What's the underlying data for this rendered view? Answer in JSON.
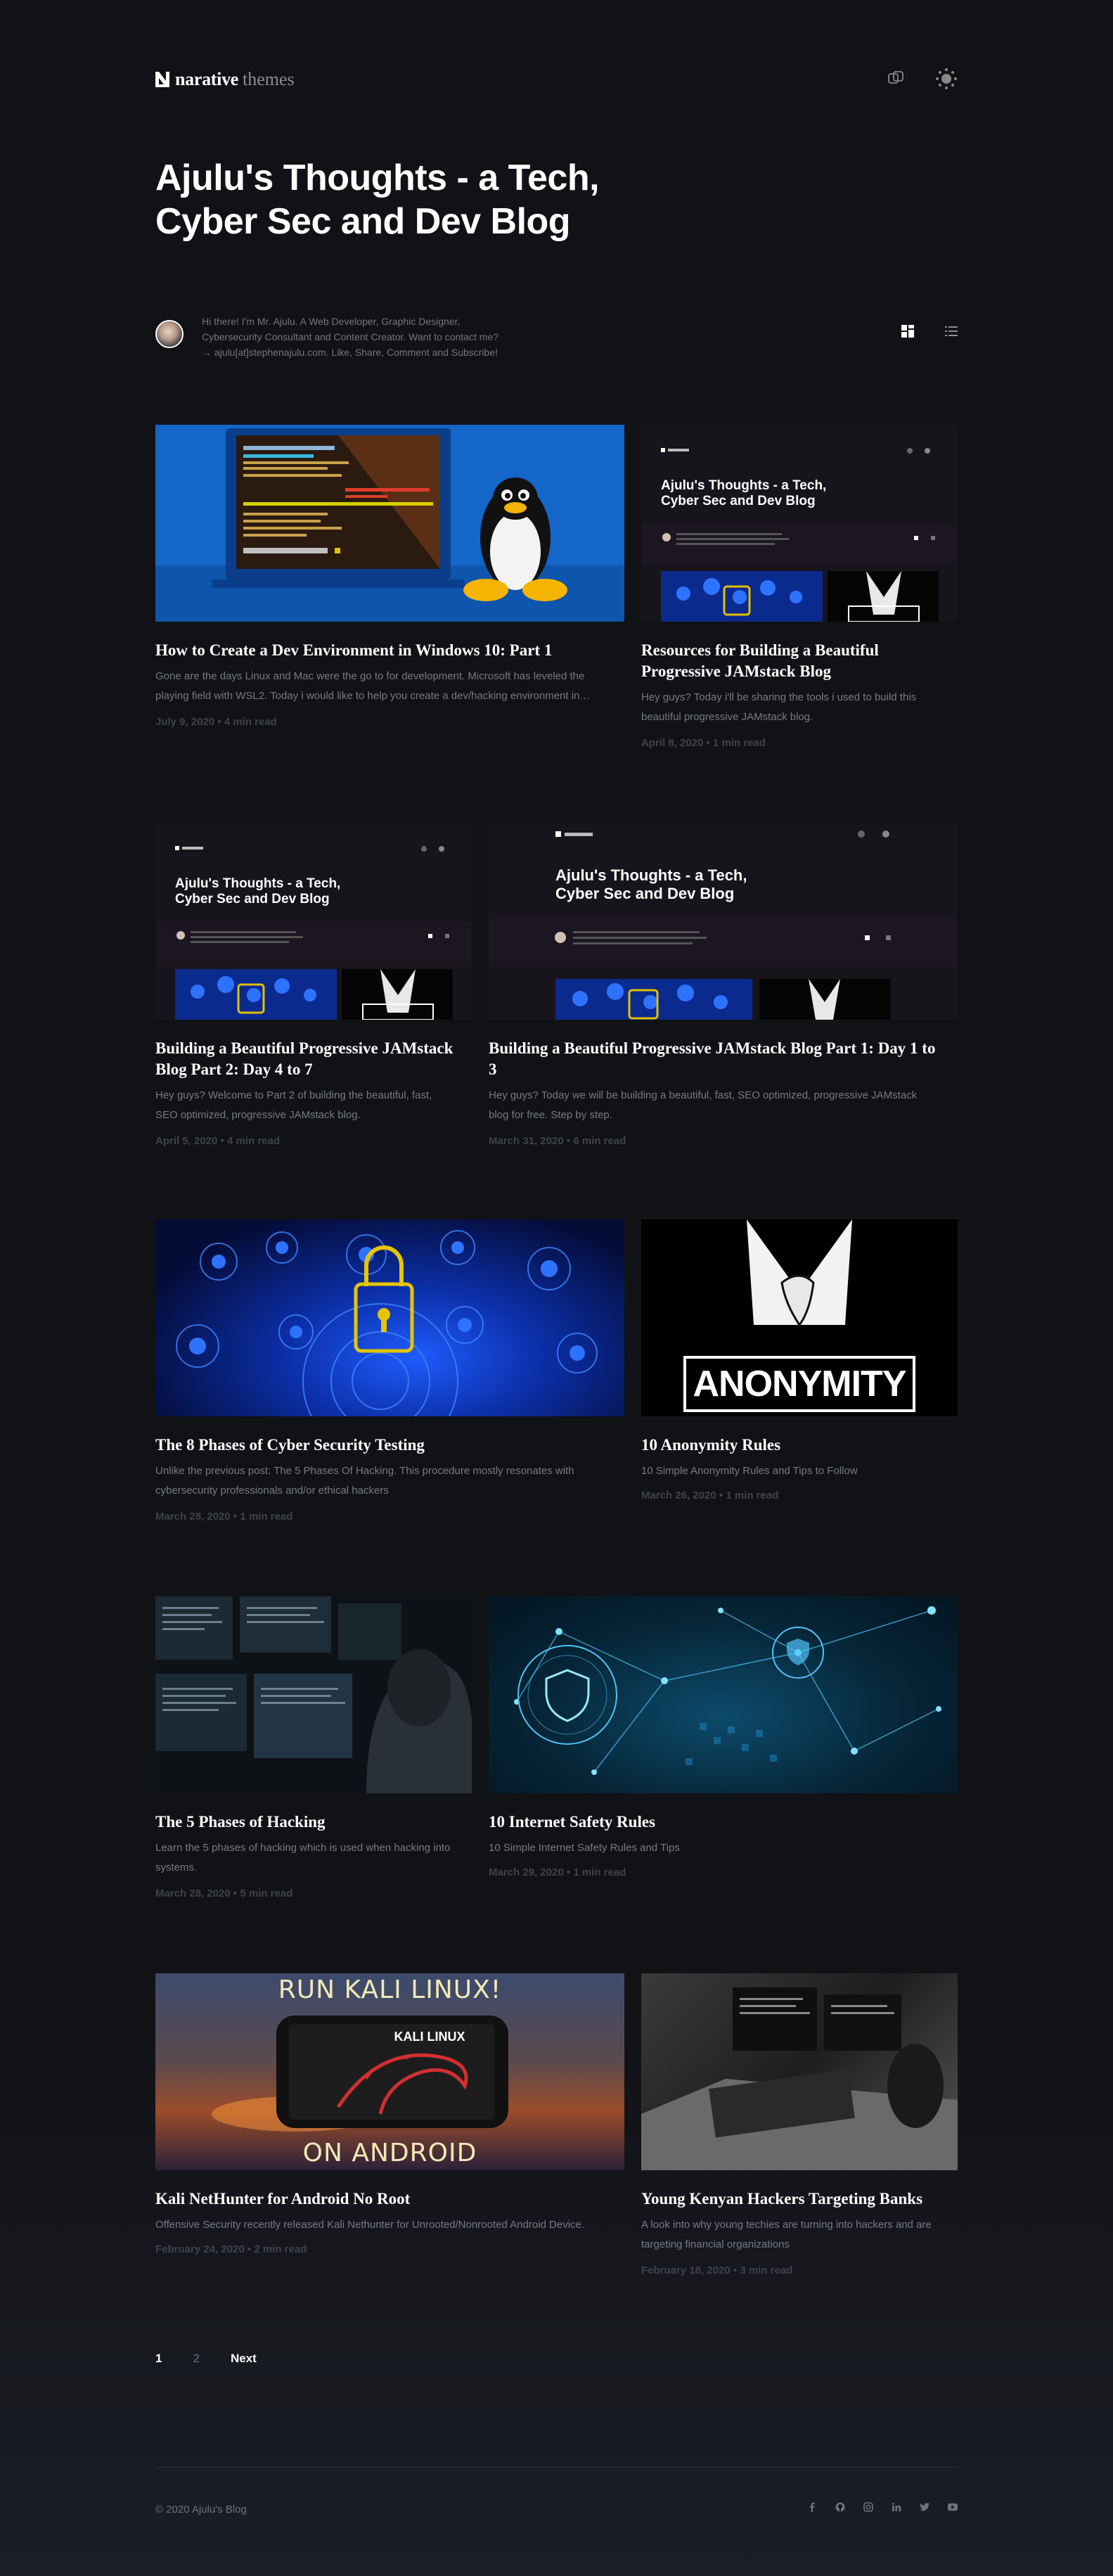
{
  "site": {
    "brand": "narative",
    "brand_sub": "themes",
    "hero_line1": "Ajulu's Thoughts - a Tech,",
    "hero_line2": "Cyber Sec and Dev Blog",
    "bio_line1": "Hi there! I'm Mr. Ajulu. A Web Developer, Graphic Designer,",
    "bio_line2": "Cybersecurity Consultant and Content Creator. Want to contact me?",
    "bio_line3": "→ ajulu[at]stephenajulu.com. Like, Share, Comment and Subscribe!"
  },
  "nav_icons": [
    "copy-link-icon",
    "theme-toggle-icon"
  ],
  "layout_icons": [
    "grid-view-icon",
    "list-view-icon"
  ],
  "posts": [
    {
      "title": "How to Create a Dev Environment in Windows 10: Part 1",
      "excerpt_1": "Gone are the days Linux and Mac were the go to for development. Microsoft has leveled the",
      "excerpt_2": "playing field with WSL2. Today i would like to help you create a dev/hacking environment in…",
      "meta": "July 9, 2020 • 4 min read"
    },
    {
      "title_1": "Resources for Building a Beautiful",
      "title_2": "Progressive JAMstack Blog",
      "excerpt_1": "Hey guys? Today i'll be sharing the tools i used to build this",
      "excerpt_2": "beautiful progressive JAMstack blog.",
      "meta": "April 8, 2020 • 1 min read"
    },
    {
      "title_1": "Building a Beautiful Progressive JAMstack",
      "title_2": "Blog Part 2: Day 4 to 7",
      "excerpt_1": "Hey guys? Welcome to Part 2 of building the beautiful, fast,",
      "excerpt_2": "SEO optimized, progressive JAMstack blog.",
      "meta": "April 5, 2020 • 4 min read"
    },
    {
      "title_1": "Building a Beautiful Progressive JAMstack Blog Part 1: Day 1 to",
      "title_2": "3",
      "excerpt_1": "Hey guys? Today we will be building a beautiful, fast, SEO optimized, progressive JAMstack",
      "excerpt_2": "blog for free. Step by step.",
      "meta": "March 31, 2020 • 6 min read"
    },
    {
      "title": "The 8 Phases of Cyber Security Testing",
      "excerpt_1": "Unlike the previous post: The 5 Phases Of Hacking. This procedure mostly resonates with",
      "excerpt_2": "cybersecurity professionals and/or ethical hackers",
      "meta": "March 28, 2020 • 1 min read"
    },
    {
      "title": "10 Anonymity Rules",
      "excerpt_1": "10 Simple Anonymity Rules and Tips to Follow",
      "meta": "March 26, 2020 • 1 min read",
      "image_text": "ANONYMITY"
    },
    {
      "title": "The 5 Phases of Hacking",
      "excerpt_1": "Learn the 5 phases of hacking which is used when hacking into",
      "excerpt_2": "systems.",
      "meta": "March 28, 2020 • 5 min read"
    },
    {
      "title": "10 Internet Safety Rules",
      "excerpt_1": "10 Simple Internet Safety Rules and Tips",
      "meta": "March 29, 2020 • 1 min read"
    },
    {
      "title": "Kali NetHunter for Android No Root",
      "excerpt_1": "Offensive Security recently released Kali Nethunter for Unrooted/Nonrooted Android Device.",
      "meta": "February 24, 2020 • 2 min read",
      "image_top": "RUN KALI LINUX!",
      "image_phone": "KALI LINUX",
      "image_bottom": "ON ANDROID"
    },
    {
      "title": "Young Kenyan Hackers Targeting Banks",
      "excerpt_1": "A look into why young techies are turning into hackers and are",
      "excerpt_2": "targeting financial organizations",
      "meta": "February 18, 2020 • 3 min read"
    }
  ],
  "pagination": {
    "page1": "1",
    "page2": "2",
    "next": "Next"
  },
  "footer": {
    "copyright": "© 2020 Ajulu's Blog",
    "social": [
      "facebook-icon",
      "github-icon",
      "instagram-icon",
      "linkedin-icon",
      "twitter-icon",
      "youtube-icon"
    ]
  },
  "colors": {
    "background": "#111216",
    "text": "#ffffff",
    "muted": "#767a80",
    "meta": "#3f4349"
  }
}
